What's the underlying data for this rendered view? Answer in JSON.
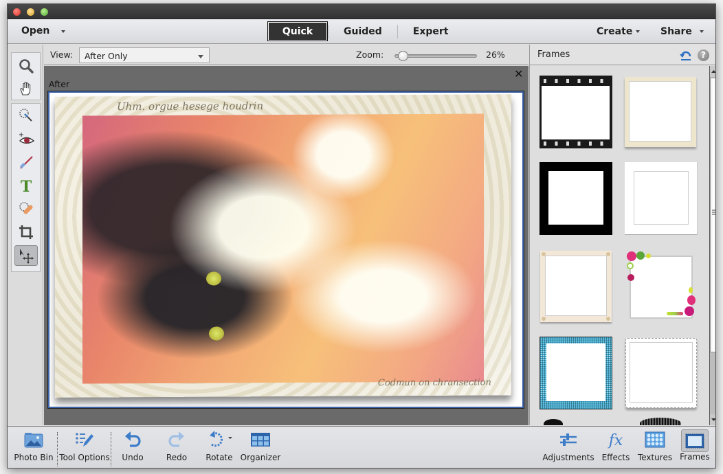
{
  "window": {
    "traffic_lights": [
      "close",
      "minimize",
      "zoom"
    ]
  },
  "topbar": {
    "open_label": "Open",
    "modes": [
      {
        "label": "Quick",
        "active": true
      },
      {
        "label": "Guided",
        "active": false
      },
      {
        "label": "Expert",
        "active": false
      }
    ],
    "create_label": "Create",
    "share_label": "Share"
  },
  "toolbox": {
    "tools": [
      {
        "name": "zoom-tool",
        "icon": "magnifier-icon"
      },
      {
        "name": "hand-tool",
        "icon": "hand-icon"
      },
      {
        "name": "quick-selection-tool",
        "icon": "quick-selection-icon"
      },
      {
        "name": "red-eye-tool",
        "icon": "eye-icon"
      },
      {
        "name": "whiten-teeth-tool",
        "icon": "toothbrush-icon"
      },
      {
        "name": "type-tool",
        "icon": "type-icon"
      },
      {
        "name": "spot-healing-tool",
        "icon": "bandage-icon"
      },
      {
        "name": "crop-tool",
        "icon": "crop-icon"
      },
      {
        "name": "move-tool",
        "icon": "move-icon",
        "selected": true
      }
    ]
  },
  "options": {
    "view_label": "View:",
    "view_value": "After Only",
    "zoom_label": "Zoom:",
    "zoom_value": "26%",
    "zoom_percent": 26
  },
  "canvas": {
    "after_label": "After",
    "close_symbol": "✕",
    "script_top": "Uhm. orgue hesege houdrin",
    "script_bottom": "Codmun on chransection"
  },
  "panel": {
    "title": "Frames",
    "help_symbol": "?",
    "frames": [
      {
        "name": "film-strip-frame"
      },
      {
        "name": "grunge-paper-frame"
      },
      {
        "name": "thick-black-frame"
      },
      {
        "name": "white-mat-frame"
      },
      {
        "name": "pinned-cream-frame"
      },
      {
        "name": "flower-corner-frame"
      },
      {
        "name": "blue-plaid-frame"
      },
      {
        "name": "scalloped-stamp-frame"
      }
    ]
  },
  "bottombar": {
    "left_buttons": [
      {
        "label": "Photo Bin",
        "icon": "photo-bin-icon"
      },
      {
        "label": "Tool Options",
        "icon": "tool-options-icon"
      },
      {
        "label": "Undo",
        "icon": "undo-icon"
      },
      {
        "label": "Redo",
        "icon": "redo-icon"
      },
      {
        "label": "Rotate",
        "icon": "rotate-icon"
      },
      {
        "label": "Organizer",
        "icon": "organizer-icon"
      }
    ],
    "right_buttons": [
      {
        "label": "Adjustments",
        "icon": "adjustments-icon"
      },
      {
        "label": "Effects",
        "icon": "effects-icon"
      },
      {
        "label": "Textures",
        "icon": "textures-icon"
      },
      {
        "label": "Frames",
        "icon": "frames-icon",
        "selected": true
      }
    ]
  },
  "colors": {
    "active_mode_bg": "#333333",
    "canvas_bg": "#6a6a6a",
    "selection_border": "#3d63a8",
    "icon_blue": "#3d7cc9"
  }
}
